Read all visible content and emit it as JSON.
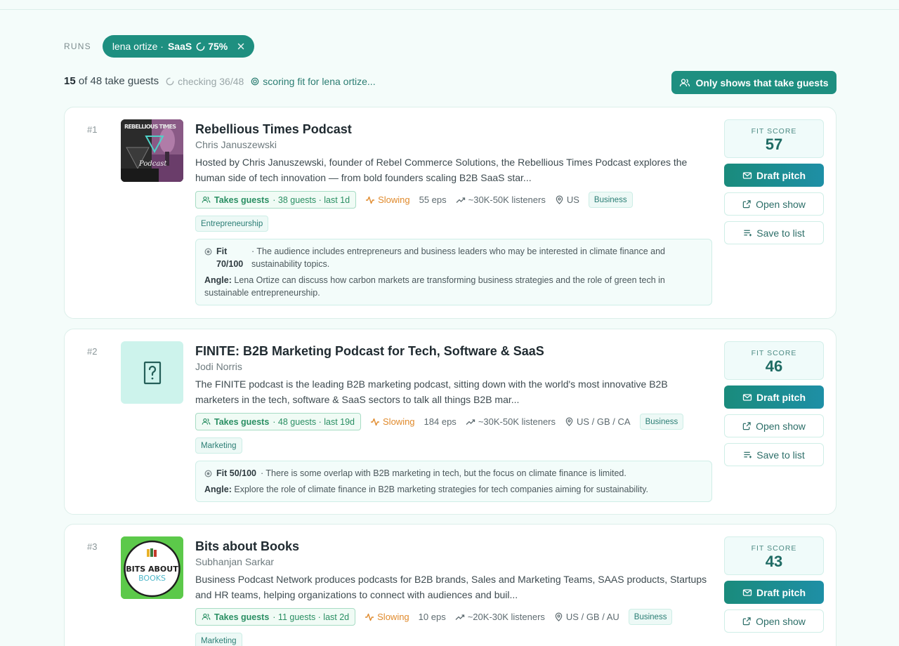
{
  "runs": {
    "label": "RUNS",
    "pill": {
      "name": "lena ortize ·",
      "segment": "SaaS",
      "progress": "75%",
      "progress_value": 0.75
    }
  },
  "summary": {
    "count_bold": "15",
    "count_rest": "of 48 take guests",
    "checking": "checking 36/48",
    "scoring": "scoring fit for lena ortize..."
  },
  "filter_button": {
    "label": "Only shows that take guests"
  },
  "colors": {
    "accent": "#1e8f80",
    "slowing": "#e08a2c",
    "takes_guests": "#2a8f63"
  },
  "results": [
    {
      "rank": "#1",
      "title": "Rebellious Times Podcast",
      "host": "Chris Januszewski",
      "description": "Hosted by Chris Januszewski, founder of Rebel Commerce Solutions, the Rebellious Times Podcast explores the human side of tech innovation — from bold founders scaling B2B SaaS star...",
      "takes_guests": "Takes guests",
      "guests_detail": "· 38 guests · last 1d",
      "trend": "Slowing",
      "episodes": "55 eps",
      "listeners": "~30K-50K listeners",
      "location": "US",
      "tags": [
        "Business",
        "Entrepreneurship"
      ],
      "fit_label": "Fit 70/100",
      "fit_text": "· The audience includes entrepreneurs and business leaders who may be interested in climate finance and sustainability topics.",
      "angle_label": "Angle:",
      "angle_text": "Lena Ortize can discuss how carbon markets are transforming business strategies and the role of green tech in sustainable entrepreneurship.",
      "fit_score_label": "FIT SCORE",
      "fit_score": "57",
      "draft_pitch": "Draft pitch",
      "open_show": "Open show",
      "save_to_list": "Save to list",
      "thumb_text_1": "REBELLIOUS TIMES",
      "thumb_text_2": "Podcast"
    },
    {
      "rank": "#2",
      "title": "FINITE: B2B Marketing Podcast for Tech, Software & SaaS",
      "host": "Jodi Norris",
      "description": "The FINITE podcast is the leading B2B marketing podcast, sitting down with the world's most innovative B2B marketers in the tech, software & SaaS sectors to talk all things B2B mar...",
      "takes_guests": "Takes guests",
      "guests_detail": "· 48 guests · last 19d",
      "trend": "Slowing",
      "episodes": "184 eps",
      "listeners": "~30K-50K listeners",
      "location": "US / GB / CA",
      "tags": [
        "Business",
        "Marketing"
      ],
      "fit_label": "Fit 50/100",
      "fit_text": "· There is some overlap with B2B marketing in tech, but the focus on climate finance is limited.",
      "angle_label": "Angle:",
      "angle_text": "Explore the role of climate finance in B2B marketing strategies for tech companies aiming for sustainability.",
      "fit_score_label": "FIT SCORE",
      "fit_score": "46",
      "draft_pitch": "Draft pitch",
      "open_show": "Open show",
      "save_to_list": "Save to list"
    },
    {
      "rank": "#3",
      "title": "Bits about Books",
      "host": "Subhanjan Sarkar",
      "description": "Business Podcast Network produces podcasts for B2B brands, Sales and Marketing Teams, SAAS products, Startups and HR teams, helping organizations to connect with audiences and buil...",
      "takes_guests": "Takes guests",
      "guests_detail": "· 11 guests · last 2d",
      "trend": "Slowing",
      "episodes": "10 eps",
      "listeners": "~20K-30K listeners",
      "location": "US / GB / AU",
      "tags": [
        "Business",
        "Marketing"
      ],
      "fit_score_label": "FIT SCORE",
      "fit_score": "43",
      "draft_pitch": "Draft pitch",
      "open_show": "Open show",
      "thumb_text_1": "BITS ABOUT",
      "thumb_text_2": "BOOKS"
    }
  ]
}
